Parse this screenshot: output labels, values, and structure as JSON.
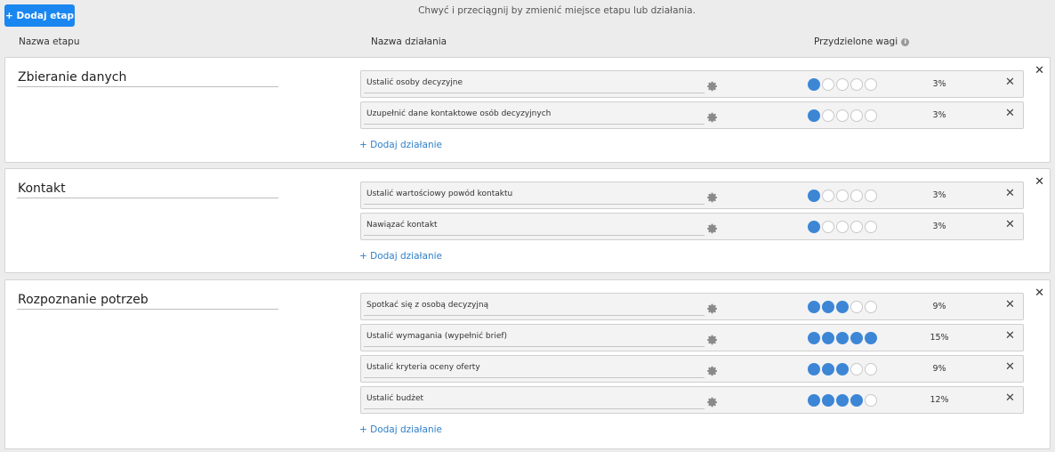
{
  "toolbar": {
    "add_stage_label": "+ Dodaj etap"
  },
  "hint": "Chwyć i przeciągnij by zmienić miejsce etapu lub działania.",
  "columns": {
    "stage": "Nazwa etapu",
    "action": "Nazwa działania",
    "weights": "Przydzielone wagi",
    "info_icon": "info-icon"
  },
  "add_action_label": "+ Dodaj działanie",
  "colors": {
    "accent": "#1a87f0",
    "dot_filled": "#3d86d6",
    "link": "#2f7fc8"
  },
  "stages": [
    {
      "name": "Zbieranie danych",
      "actions": [
        {
          "name": "Ustalić osoby decyzyjne",
          "weight": 1,
          "percent": "3%"
        },
        {
          "name": "Uzupełnić dane kontaktowe osób decyzyjnych",
          "weight": 1,
          "percent": "3%"
        }
      ]
    },
    {
      "name": "Kontakt",
      "actions": [
        {
          "name": "Ustalić wartościowy powód kontaktu",
          "weight": 1,
          "percent": "3%"
        },
        {
          "name": "Nawiązać kontakt",
          "weight": 1,
          "percent": "3%"
        }
      ]
    },
    {
      "name": "Rozpoznanie potrzeb",
      "actions": [
        {
          "name": "Spotkać się z osobą decyzyjną",
          "weight": 3,
          "percent": "9%"
        },
        {
          "name": "Ustalić wymagania (wypełnić brief)",
          "weight": 5,
          "percent": "15%"
        },
        {
          "name": "Ustalić kryteria oceny oferty",
          "weight": 3,
          "percent": "9%"
        },
        {
          "name": "Ustalić budżet",
          "weight": 4,
          "percent": "12%"
        }
      ]
    }
  ],
  "max_weight": 5
}
